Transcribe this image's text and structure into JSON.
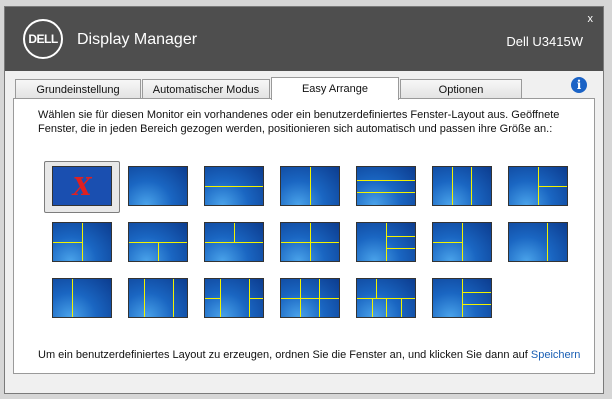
{
  "titlebar": {
    "logo": "DELL",
    "app_title": "Display Manager",
    "model": "Dell U3415W",
    "close": "x"
  },
  "tabs": [
    {
      "label": "Grundeinstellung"
    },
    {
      "label": "Automatischer Modus"
    },
    {
      "label": "Easy Arrange"
    },
    {
      "label": "Optionen"
    }
  ],
  "active_tab": "Easy Arrange",
  "info_icon": "i",
  "panel": {
    "instructions": "Wählen sie für diesen Monitor ein vorhandenes oder ein benutzerdefiniertes Fenster-Layout aus.  Geöffnete Fenster, die in jeden Bereich gezogen werden, positionieren sich automatisch und passen ihre Größe an.:",
    "selected_layout_mark": "X",
    "footer_text": "Um ein benutzerdefiniertes Layout zu erzeugen, ordnen Sie die Fenster an, und klicken Sie dann auf ",
    "footer_link": "Speichern"
  },
  "colors": {
    "titlebar": "#4e4e4e",
    "divider_lines": "#f2f200",
    "link": "#1a5fb4"
  }
}
